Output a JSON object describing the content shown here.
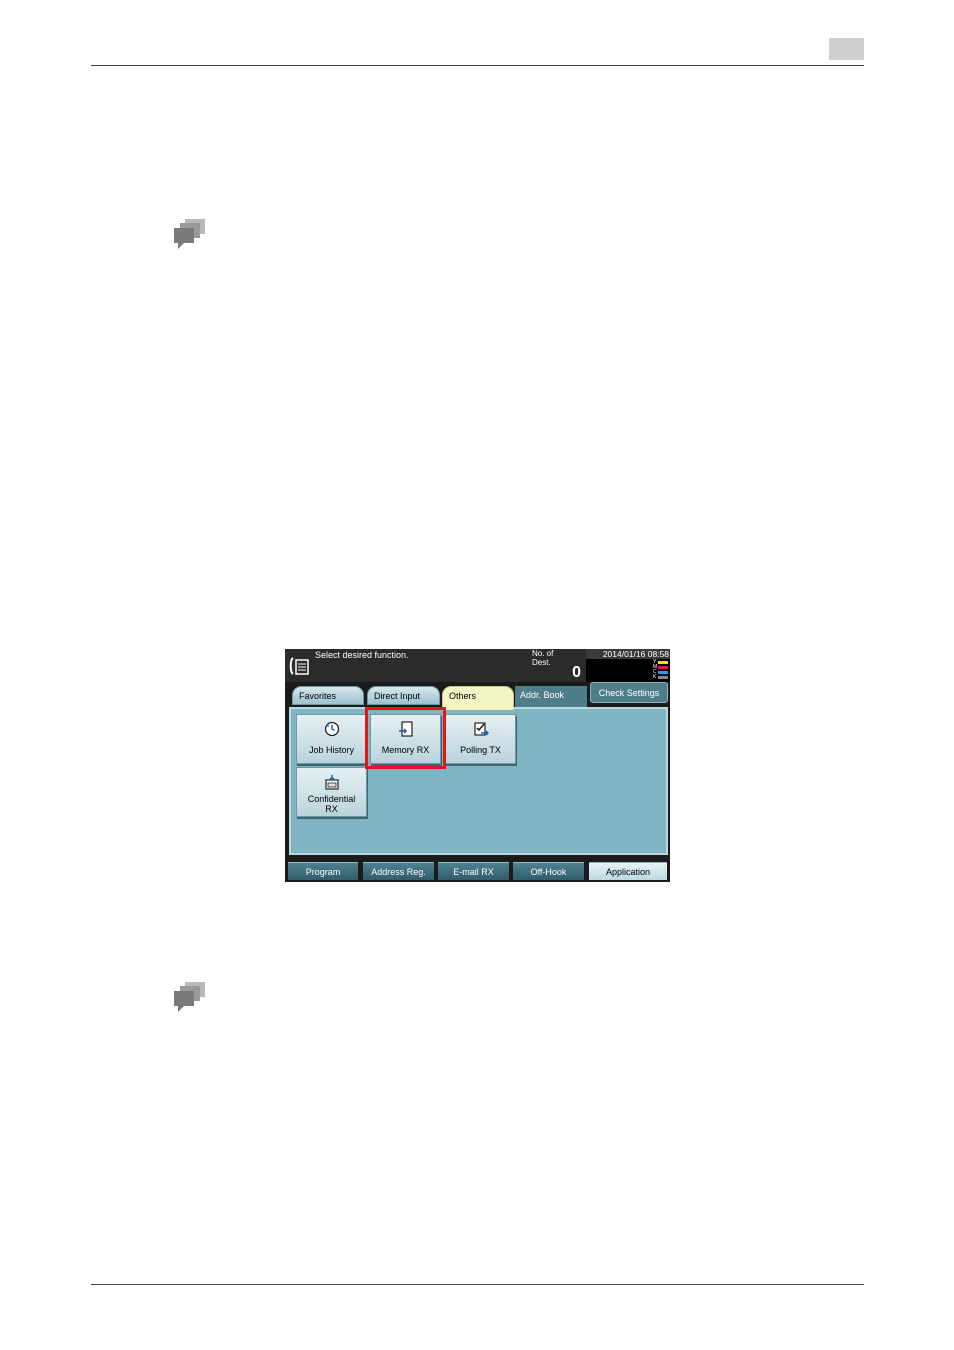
{
  "status": {
    "message": "Select desired function.",
    "dest_label_line1": "No. of",
    "dest_label_line2": "Dest.",
    "dest_count": "0",
    "datetime": "2014/01/16 08:58",
    "toner": [
      {
        "letter": "Y",
        "color": "#f2e600"
      },
      {
        "letter": "M",
        "color": "#e0106c"
      },
      {
        "letter": "C",
        "color": "#1a9fe0"
      },
      {
        "letter": "K",
        "color": "#111111"
      }
    ]
  },
  "tabs": {
    "favorites": "Favorites",
    "direct_input": "Direct Input",
    "others": "Others",
    "addr_book": "Addr. Book",
    "check_settings": "Check Settings"
  },
  "functions": {
    "job_history": "Job History",
    "memory_rx": "Memory RX",
    "polling_tx": "Polling TX",
    "confidential_line1": "Confidential",
    "confidential_line2": "RX"
  },
  "bottom": {
    "program": "Program",
    "address_reg": "Address Reg.",
    "email_rx": "E-mail RX",
    "off_hook": "Off-Hook",
    "application": "Application"
  },
  "colors": {
    "highlight": "#e0161b",
    "content_bg": "#7fb4c3",
    "active_tab": "#f3f5c4"
  }
}
